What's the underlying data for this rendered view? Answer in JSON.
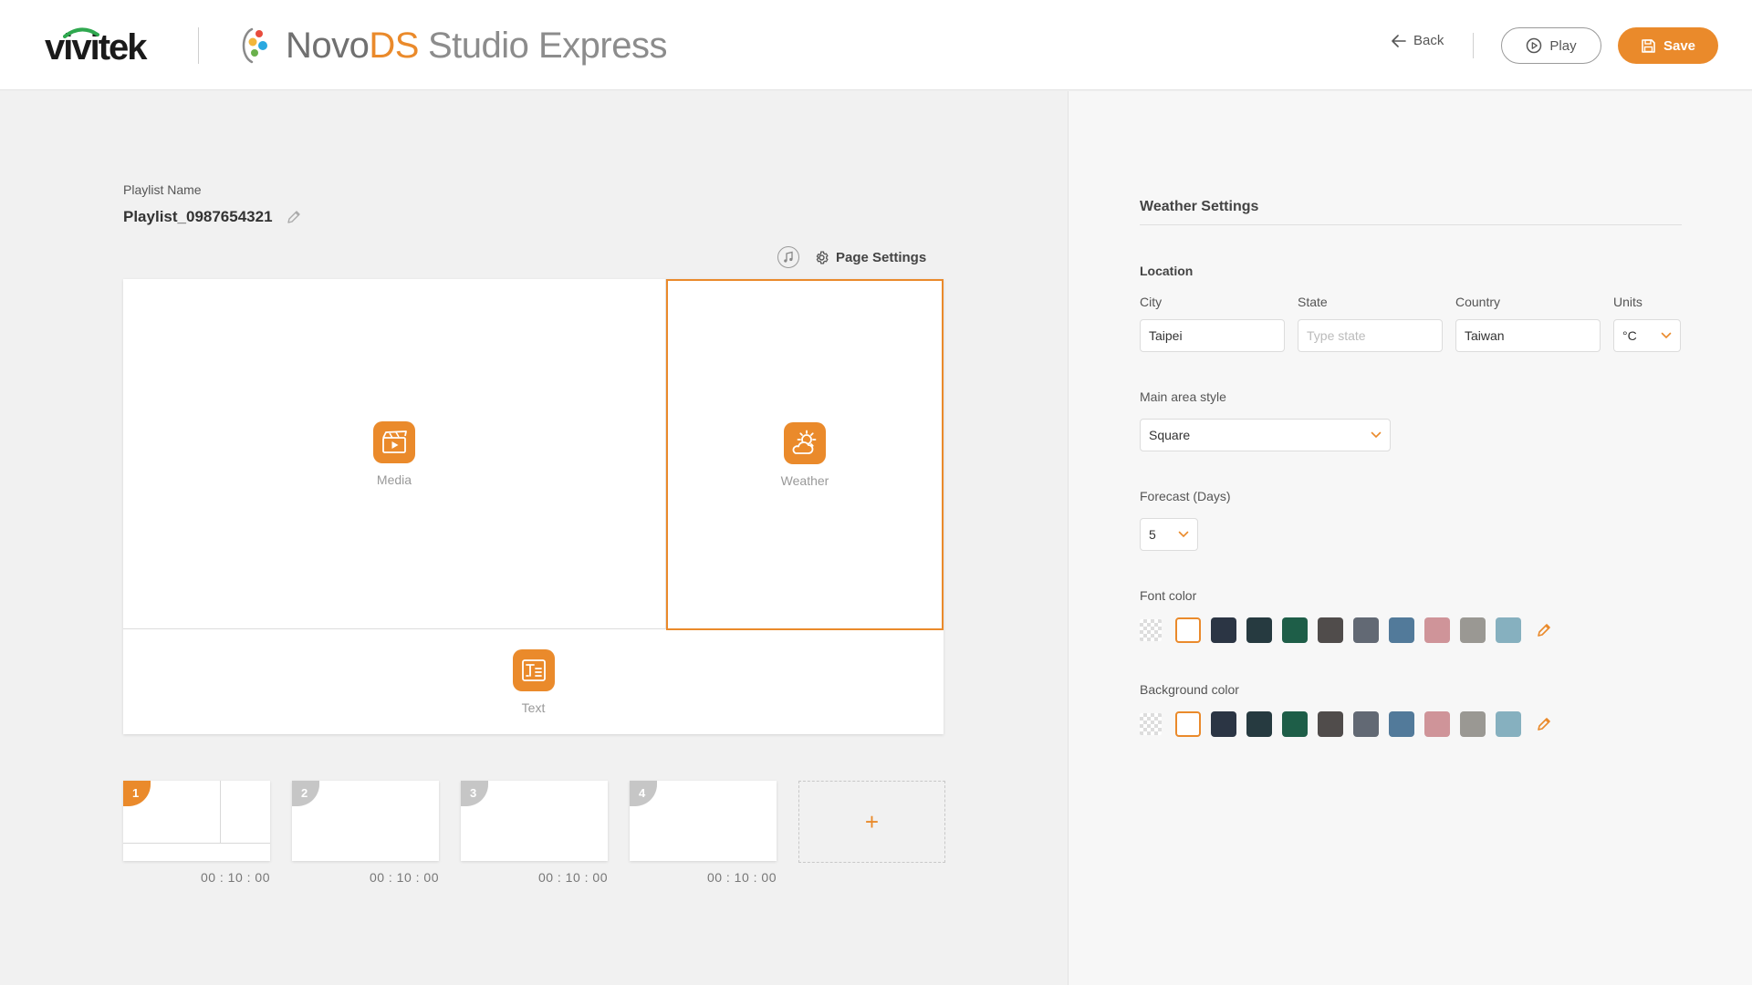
{
  "header": {
    "brand": "vivitek",
    "app_name_novo": "Novo",
    "app_name_ds": "DS",
    "app_name_studio": "Studio Express",
    "back_label": "Back",
    "play_label": "Play",
    "save_label": "Save"
  },
  "playlist": {
    "name_label": "Playlist Name",
    "name": "Playlist_0987654321",
    "page_settings_label": "Page Settings"
  },
  "canvas": {
    "zones": [
      {
        "label": "Media",
        "icon": "media-icon"
      },
      {
        "label": "Weather",
        "icon": "weather-icon",
        "selected": true
      },
      {
        "label": "Text",
        "icon": "text-icon"
      }
    ]
  },
  "pages": [
    {
      "number": "1",
      "time": "00 : 10 : 00",
      "active": true
    },
    {
      "number": "2",
      "time": "00 : 10 : 00",
      "active": false
    },
    {
      "number": "3",
      "time": "00 : 10 : 00",
      "active": false
    },
    {
      "number": "4",
      "time": "00 : 10 : 00",
      "active": false
    }
  ],
  "add_page_symbol": "+",
  "weather_settings": {
    "title": "Weather Settings",
    "location_label": "Location",
    "city_label": "City",
    "city_value": "Taipei",
    "state_label": "State",
    "state_value": "",
    "state_placeholder": "Type state",
    "country_label": "Country",
    "country_value": "Taiwan",
    "units_label": "Units",
    "units_value": "°C",
    "main_area_style_label": "Main area style",
    "main_area_style_value": "Square",
    "forecast_label": "Forecast (Days)",
    "forecast_value": "5",
    "font_color_label": "Font color",
    "background_color_label": "Background color"
  },
  "colors": {
    "accent": "#ea8a2b",
    "swatches": [
      "transparent",
      "#ffffff",
      "#2b3544",
      "#263a40",
      "#1e5e48",
      "#504c4b",
      "#626974",
      "#527a9a",
      "#cf9499",
      "#9a9893",
      "#86b0bf"
    ]
  }
}
